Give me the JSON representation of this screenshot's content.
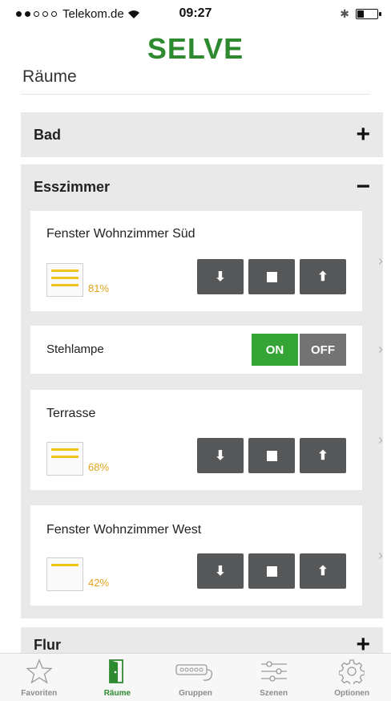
{
  "status_bar": {
    "carrier": "Telekom.de",
    "time": "09:27",
    "signal_dots_filled": 2,
    "signal_dots_total": 5
  },
  "header": {
    "logo": "SELVE",
    "title": "Räume"
  },
  "rooms": {
    "bad": {
      "name": "Bad",
      "sign": "+"
    },
    "esszimmer": {
      "name": "Esszimmer",
      "sign": "−",
      "devices": [
        {
          "name": "Fenster Wohnzimmer Süd",
          "position_label": "81%",
          "position": 81
        },
        {
          "name": "Stehlampe",
          "on_label": "ON",
          "off_label": "OFF",
          "state": "on"
        },
        {
          "name": "Terrasse",
          "position_label": "68%",
          "position": 68
        },
        {
          "name": "Fenster Wohnzimmer West",
          "position_label": "42%",
          "position": 42
        }
      ]
    },
    "flur": {
      "name": "Flur",
      "sign": "+"
    }
  },
  "tabs": [
    {
      "label": "Favoriten",
      "icon": "star-icon",
      "active": false
    },
    {
      "label": "Räume",
      "icon": "door-icon",
      "active": true
    },
    {
      "label": "Gruppen",
      "icon": "group-icon",
      "active": false
    },
    {
      "label": "Szenen",
      "icon": "sliders-icon",
      "active": false
    },
    {
      "label": "Optionen",
      "icon": "gear-icon",
      "active": false
    }
  ],
  "colors": {
    "brand_green": "#2e8a2f",
    "on_green": "#34a534",
    "off_gray": "#737373",
    "button_gray": "#555758",
    "percent_amber": "#e3a21a"
  }
}
